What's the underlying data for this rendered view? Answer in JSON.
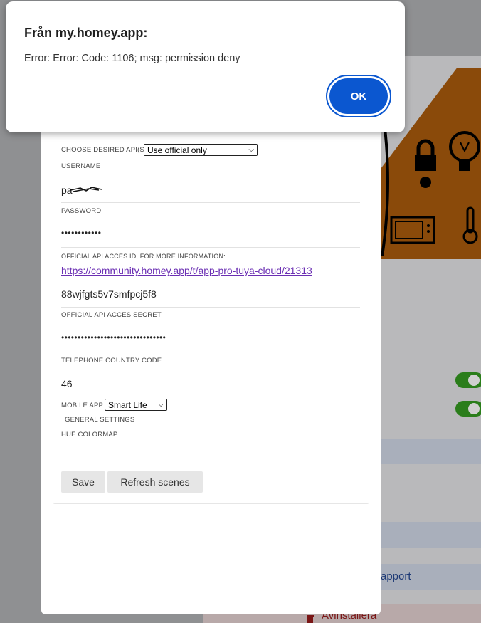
{
  "alert": {
    "title": "Från my.homey.app:",
    "message": "Error: Error: Code: 1106; msg: permission deny",
    "ok_label": "OK"
  },
  "settings": {
    "api_label": "CHOOSE DESIRED API(S)",
    "api_value": "Use official only",
    "username_label": "USERNAME",
    "username_value": "pa",
    "password_label": "PASSWORD",
    "password_value": "••••••••••••",
    "api_id_label": "OFFICIAL API ACCES ID, FOR MORE INFORMATION:",
    "api_id_link": "https://community.homey.app/t/app-pro-tuya-cloud/21313",
    "api_id_value": "88wjfgts5v7smfpcj5f8",
    "secret_label": "OFFICIAL API ACCES SECRET",
    "secret_value": "••••••••••••••••••••••••••••••••",
    "phone_label": "TELEPHONE COUNTRY CODE",
    "phone_value": "46",
    "mobile_app_label": "MOBILE APP",
    "mobile_app_value": "Smart Life",
    "general_settings_label": "GENERAL SETTINGS",
    "hue_label": "HUE COLORMAP",
    "save_label": "Save",
    "refresh_label": "Refresh scenes"
  },
  "background": {
    "support_label": "apport",
    "uninstall_label": "Avinstallera"
  },
  "colors": {
    "accent": "#0b57d0",
    "link": "#6b2fb3",
    "toggle_on": "#2a7d1a"
  }
}
